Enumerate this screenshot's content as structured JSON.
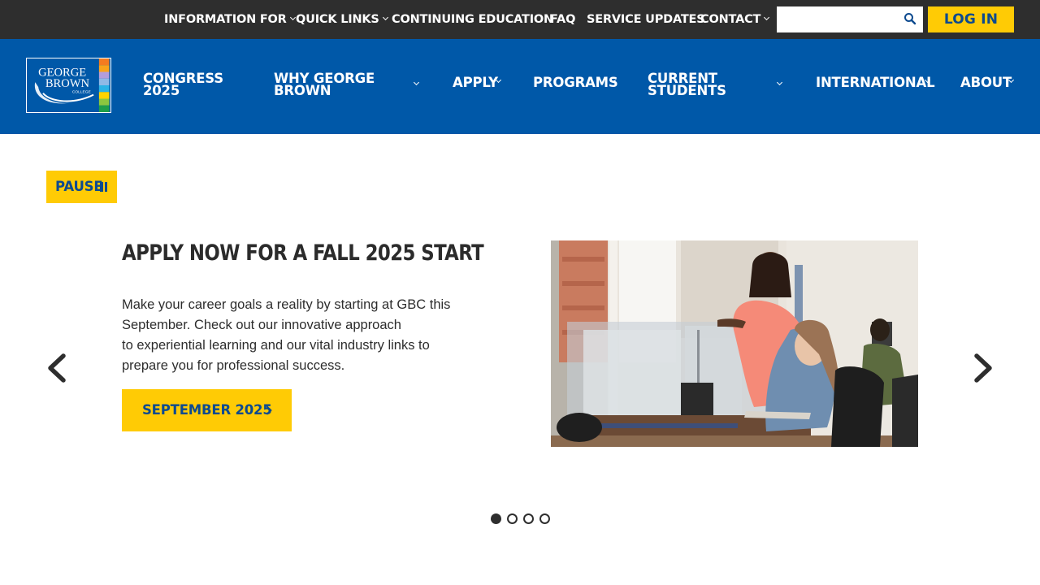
{
  "utility": {
    "links": [
      {
        "label": "INFORMATION FOR",
        "dropdown": true
      },
      {
        "label": "QUICK LINKS",
        "dropdown": true
      },
      {
        "label": "CONTINUING EDUCATION",
        "dropdown": false
      },
      {
        "label": "FAQ",
        "dropdown": false
      },
      {
        "label": "SERVICE UPDATES",
        "dropdown": false
      },
      {
        "label": "CONTACT",
        "dropdown": true
      }
    ],
    "search": {
      "value": "",
      "placeholder": ""
    },
    "login_label": "LOG IN"
  },
  "logo": {
    "lines": [
      "GEORGE",
      "BROWN",
      "COLLEGE"
    ]
  },
  "nav": {
    "items": [
      {
        "label_lines": [
          "CONGRESS",
          "2025"
        ],
        "dropdown": false
      },
      {
        "label_lines": [
          "WHY GEORGE",
          "BROWN"
        ],
        "dropdown": true
      },
      {
        "label_lines": [
          "APPLY"
        ],
        "dropdown": true
      },
      {
        "label_lines": [
          "PROGRAMS"
        ],
        "dropdown": true
      },
      {
        "label_lines": [
          "CURRENT",
          "STUDENTS"
        ],
        "dropdown": true
      },
      {
        "label_lines": [
          "INTERNATIONAL"
        ],
        "dropdown": true
      },
      {
        "label_lines": [
          "ABOUT"
        ],
        "dropdown": true
      }
    ]
  },
  "carousel": {
    "pause_label": "PAUSE",
    "slide": {
      "title": "APPLY NOW FOR A FALL 2025 START",
      "body_lines": [
        "Make your career goals a reality by starting at GBC this",
        "September. Check out our innovative approach",
        "to experiential learning and our vital industry links to",
        "prepare you for professional success."
      ],
      "cta_label": "SEPTEMBER 2025"
    },
    "total_slides": 4,
    "active_slide": 1
  },
  "colors": {
    "utility_bg": "#2e2e2e",
    "nav_bg": "#0058a8",
    "accent_yellow": "#ffcb05",
    "button_text_blue": "#0d4a8f",
    "text_dark": "#2d2d2d"
  }
}
